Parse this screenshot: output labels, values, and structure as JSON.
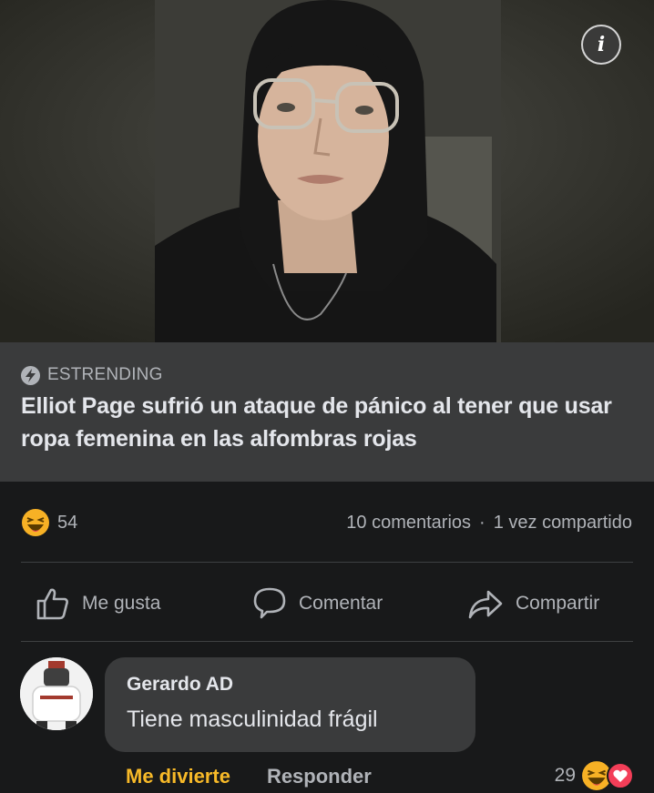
{
  "post": {
    "photo": {
      "info_icon": "info-icon",
      "info_glyph": "i"
    },
    "link": {
      "source_icon": "lightning-bolt-icon",
      "source": "ESTRENDING",
      "headline": "Elliot Page sufrió un ataque de pánico al tener que usar ropa femenina en las alfombras rojas"
    },
    "stats": {
      "reaction_icon": "haha-emoji-icon",
      "reaction_count": "54",
      "comments": "10 comentarios",
      "separator": "·",
      "shares": "1 vez compartido"
    },
    "actions": {
      "like": {
        "icon": "thumbs-up-icon",
        "label": "Me gusta"
      },
      "comment": {
        "icon": "speech-bubble-icon",
        "label": "Comentar"
      },
      "share": {
        "icon": "share-arrow-icon",
        "label": "Compartir"
      }
    }
  },
  "comment": {
    "avatar_icon": "user-avatar",
    "author": "Gerardo AD",
    "text": "Tiene masculinidad frágil",
    "reaction_label": "Me divierte",
    "reply_label": "Responder",
    "reaction_count": "29",
    "reaction_icons": [
      "haha-emoji-icon",
      "love-heart-icon"
    ]
  },
  "colors": {
    "background": "#18191a",
    "card": "#3a3b3c",
    "text_primary": "#e4e6eb",
    "text_secondary": "#b0b3b8",
    "haha_reaction": "#f7b125",
    "love_reaction": "#f33e58"
  }
}
